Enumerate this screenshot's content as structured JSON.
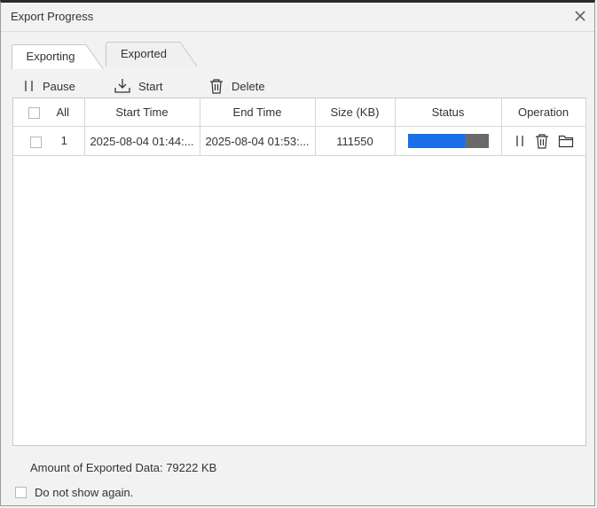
{
  "window": {
    "title": "Export Progress"
  },
  "tabs": [
    {
      "label": "Exporting",
      "active": true
    },
    {
      "label": "Exported",
      "active": false
    }
  ],
  "toolbar": {
    "pause_label": "Pause",
    "start_label": "Start",
    "delete_label": "Delete"
  },
  "table": {
    "headers": [
      "All",
      "Start Time",
      "End Time",
      "Size (KB)",
      "Status",
      "Operation"
    ],
    "rows": [
      {
        "index": "1",
        "start_time": "2025-08-04 01:44:...",
        "end_time": "2025-08-04 01:53:...",
        "size_kb": "111550",
        "progress_fraction": 0.71
      }
    ]
  },
  "footer": {
    "amount_text": "Amount of Exported Data: 79222 KB",
    "dont_show_label": "Do not show again."
  },
  "colors": {
    "progress_fill": "#1a6fe8",
    "progress_track": "#6a6a6a",
    "background": "#f2f2f2"
  }
}
